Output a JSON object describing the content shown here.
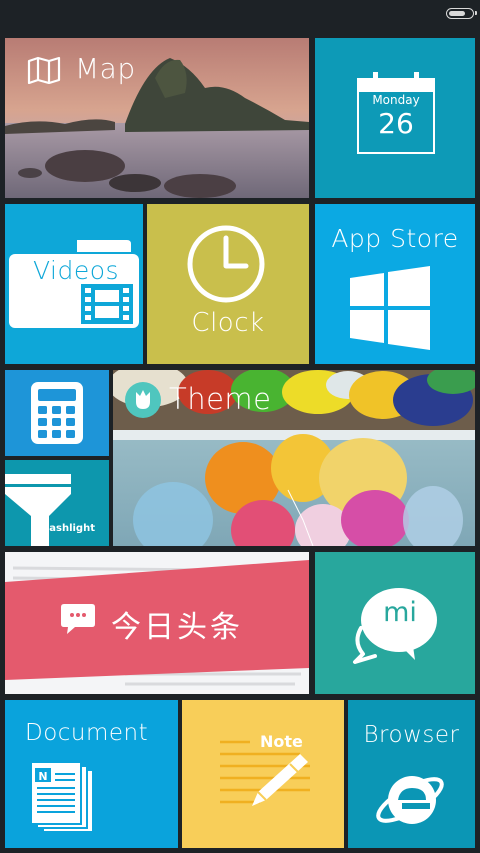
{
  "status_bar": {
    "battery_level": 0.75
  },
  "tiles": {
    "map": {
      "label": "Map",
      "icon": "map-icon"
    },
    "calendar": {
      "weekday": "Monday",
      "day": "26",
      "icon": "calendar-icon"
    },
    "videos": {
      "label": "Videos",
      "icon": "video-folder-icon"
    },
    "clock": {
      "label": "Clock",
      "icon": "clock-icon"
    },
    "app_store": {
      "label": "App Store",
      "icon": "windows-logo-icon"
    },
    "calculator": {
      "icon": "calculator-icon"
    },
    "flashlight": {
      "label": "Flashlight",
      "icon": "flashlight-icon"
    },
    "theme": {
      "label": "Theme",
      "icon": "tulip-icon"
    },
    "toutiao": {
      "label": "今日头条",
      "icon": "chat-bubble-icon"
    },
    "mi": {
      "label": "mi",
      "icon": "mi-talk-icon"
    },
    "document": {
      "label": "Document",
      "icon": "document-stack-icon"
    },
    "note": {
      "label": "Note",
      "icon": "pen-icon"
    },
    "browser": {
      "label": "Browser",
      "icon": "internet-explorer-icon"
    }
  },
  "colors": {
    "background": "#1d2226",
    "calendar": "#0d9ab7",
    "videos": "#0ea7d8",
    "clock": "#c9bf4c",
    "app_store": "#0ba9e3",
    "calculator": "#1e95d8",
    "flashlight": "#0d97ad",
    "toutiao_red": "#e45a6d",
    "mi": "#28a79d",
    "document": "#0aa3dc",
    "note": "#f8ce59",
    "browser": "#0b96b5"
  }
}
